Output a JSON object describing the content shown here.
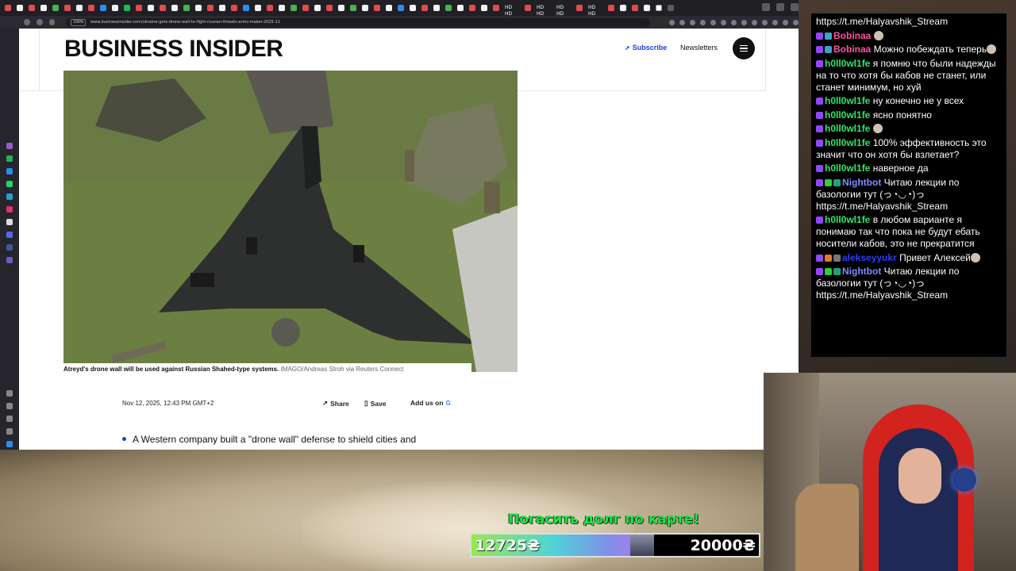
{
  "browser": {
    "url": "www.businessinsider.com/ukraine-gets-drone-wall-to-fight-russian-threats-arms-maker-2025-11",
    "url_badge": "100%",
    "tab_labels": [
      "HD HD",
      "HD HD",
      "HD HD",
      "HD HD"
    ]
  },
  "site": {
    "logo": "BUSINESS INSIDER",
    "subscribe": "Subscribe",
    "newsletters": "Newsletters"
  },
  "article": {
    "caption": "Atreyd's drone wall will be used against Russian Shahed-type systems.",
    "credit": "IMAGO/Andreas Stroh via Reuters Connect",
    "date": "Nov 12, 2025, 12:43 PM GMT+2",
    "share": "Share",
    "save": "Save",
    "add_us_on": "Add us on",
    "bullet": "A Western company built a \"drone wall\" defense to shield cities and"
  },
  "chat": {
    "messages": [
      {
        "user": "",
        "color": "#ffffff",
        "text": "https://t.me/Halyavshik_Stream",
        "badges": []
      },
      {
        "user": "Bobinaa",
        "color": "#ff4fa3",
        "text": "",
        "badges": [
          "#9147ff",
          "#3aa3c8"
        ],
        "emote": true
      },
      {
        "user": "Bobinaa",
        "color": "#ff4fa3",
        "text": "Можно побеждать теперь",
        "badges": [
          "#9147ff",
          "#3aa3c8"
        ],
        "emote": true
      },
      {
        "user": "h0ll0wl1fe",
        "color": "#2ee86a",
        "text": "я помню что были надежды на то что хотя бы кабов не станет, или станет минимум, но хуй",
        "badges": [
          "#9147ff"
        ]
      },
      {
        "user": "h0ll0wl1fe",
        "color": "#2ee86a",
        "text": "ну конечно не у всех",
        "badges": [
          "#9147ff"
        ]
      },
      {
        "user": "h0ll0wl1fe",
        "color": "#2ee86a",
        "text": "ясно понятно",
        "badges": [
          "#9147ff"
        ]
      },
      {
        "user": "h0ll0wl1fe",
        "color": "#2ee86a",
        "text": "",
        "badges": [
          "#9147ff"
        ],
        "emote": true
      },
      {
        "user": "h0ll0wl1fe",
        "color": "#2ee86a",
        "text": "100% эффективность это значит что он хотя бы взлетает?",
        "badges": [
          "#9147ff"
        ]
      },
      {
        "user": "h0ll0wl1fe",
        "color": "#2ee86a",
        "text": "наверное да",
        "badges": [
          "#9147ff"
        ]
      },
      {
        "user": "Nightbot",
        "color": "#7c8cff",
        "text": "Читаю лекции по базологии тут (っ◔◡◔)っ https://t.me/Halyavshik_Stream",
        "badges": [
          "#9147ff",
          "#2ecc40",
          "#1aa37a"
        ]
      },
      {
        "user": "h0ll0wl1fe",
        "color": "#2ee86a",
        "text": "в любом варианте я понимаю так что пока не будут ебать носители кабов, это не прекратится",
        "badges": [
          "#9147ff"
        ]
      },
      {
        "user": "alekseyyukr",
        "color": "#2a3cff",
        "text": "Привет Алексей",
        "badges": [
          "#9147ff",
          "#e07a2a",
          "#777777"
        ],
        "emote": true
      },
      {
        "user": "Nightbot",
        "color": "#7c8cff",
        "text": "Читаю лекции по базологии тут (っ◔◡◔)っ https://t.me/Halyavshik_Stream",
        "badges": [
          "#9147ff",
          "#2ecc40",
          "#1aa37a"
        ]
      }
    ]
  },
  "donation": {
    "title": "Погасить долг по карте!",
    "current": "12725₴",
    "goal": "20000₴",
    "progress": 0.636
  }
}
